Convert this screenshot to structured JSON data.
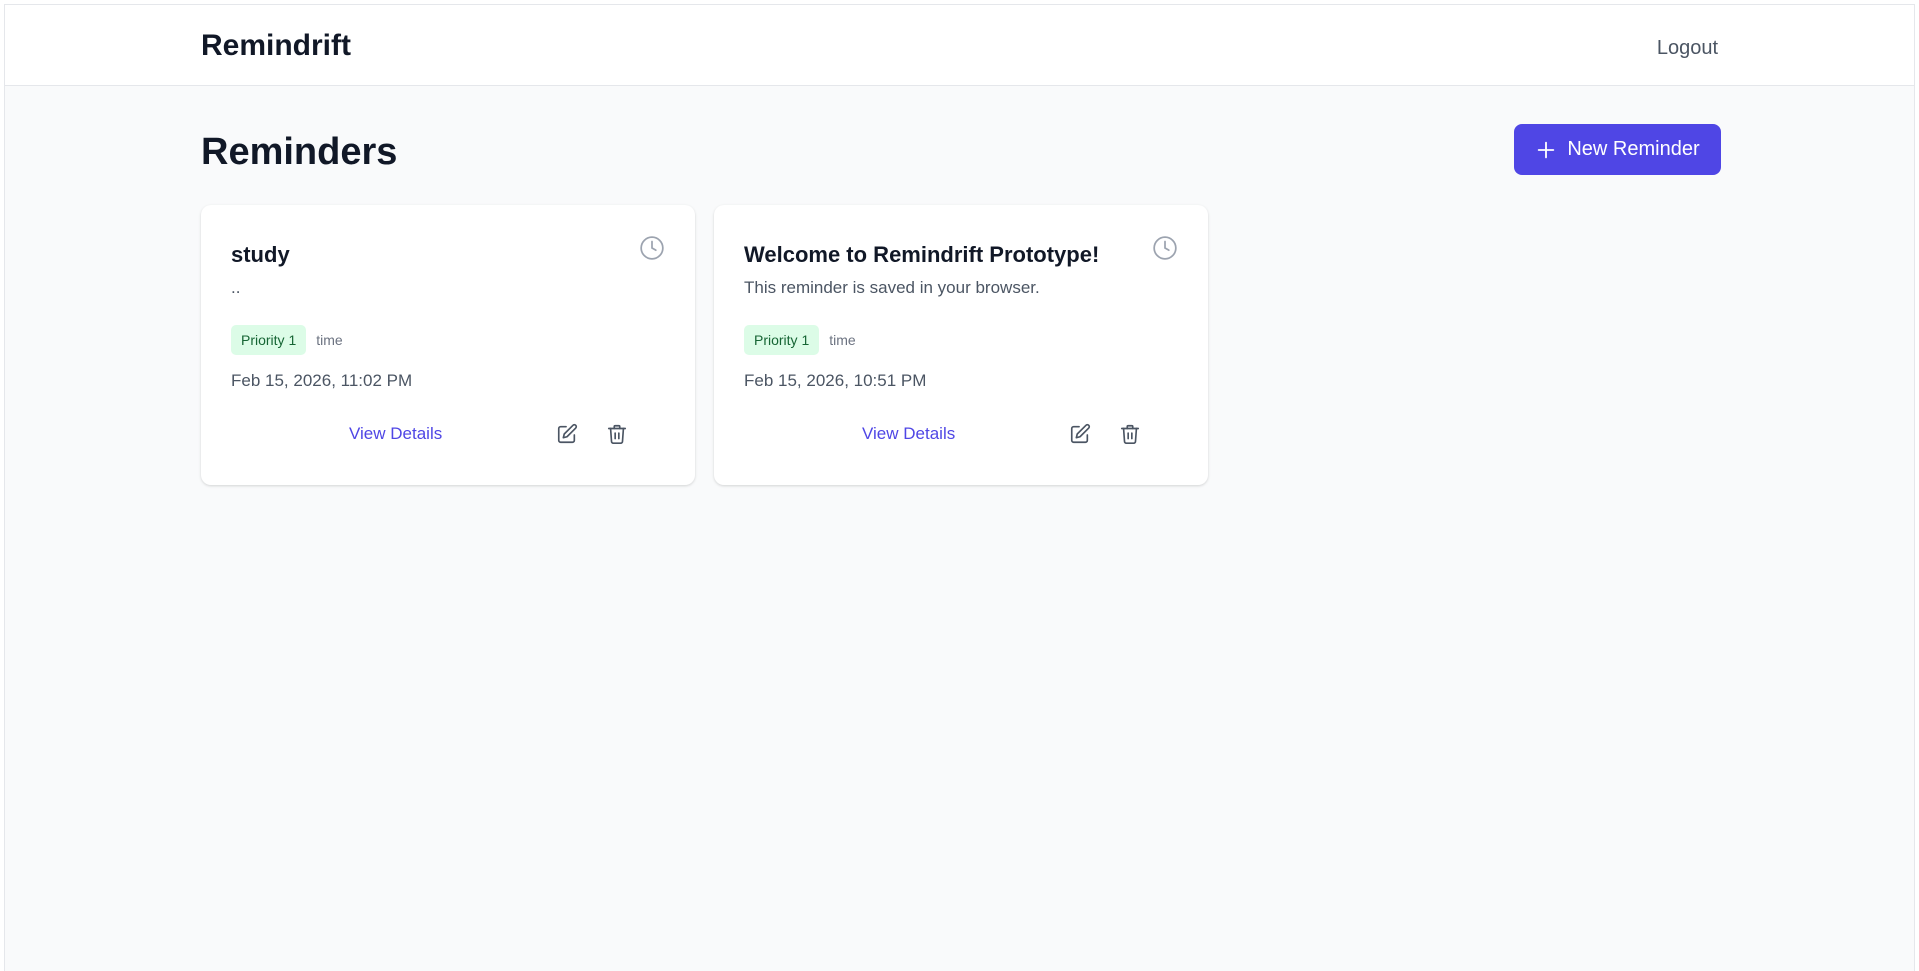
{
  "header": {
    "brand": "Remindrift",
    "logout_label": "Logout"
  },
  "main": {
    "title": "Reminders",
    "new_button_label": "New Reminder"
  },
  "reminders": [
    {
      "title": "study",
      "description": "..",
      "priority": "Priority 1",
      "tag": "time",
      "datetime": "Feb 15, 2026, 11:02 PM",
      "view_label": "View Details"
    },
    {
      "title": "Welcome to Remindrift Prototype!",
      "description": "This reminder is saved in your browser.",
      "priority": "Priority 1",
      "tag": "time",
      "datetime": "Feb 15, 2026, 10:51 PM",
      "view_label": "View Details"
    }
  ],
  "icons": {
    "add": "plus-icon",
    "clock": "clock-icon",
    "edit": "edit-icon",
    "delete": "trash-icon"
  },
  "colors": {
    "accent": "#4f46e5",
    "priority_bg": "#dcfce7",
    "priority_text": "#166534",
    "background": "#f9fafb"
  }
}
